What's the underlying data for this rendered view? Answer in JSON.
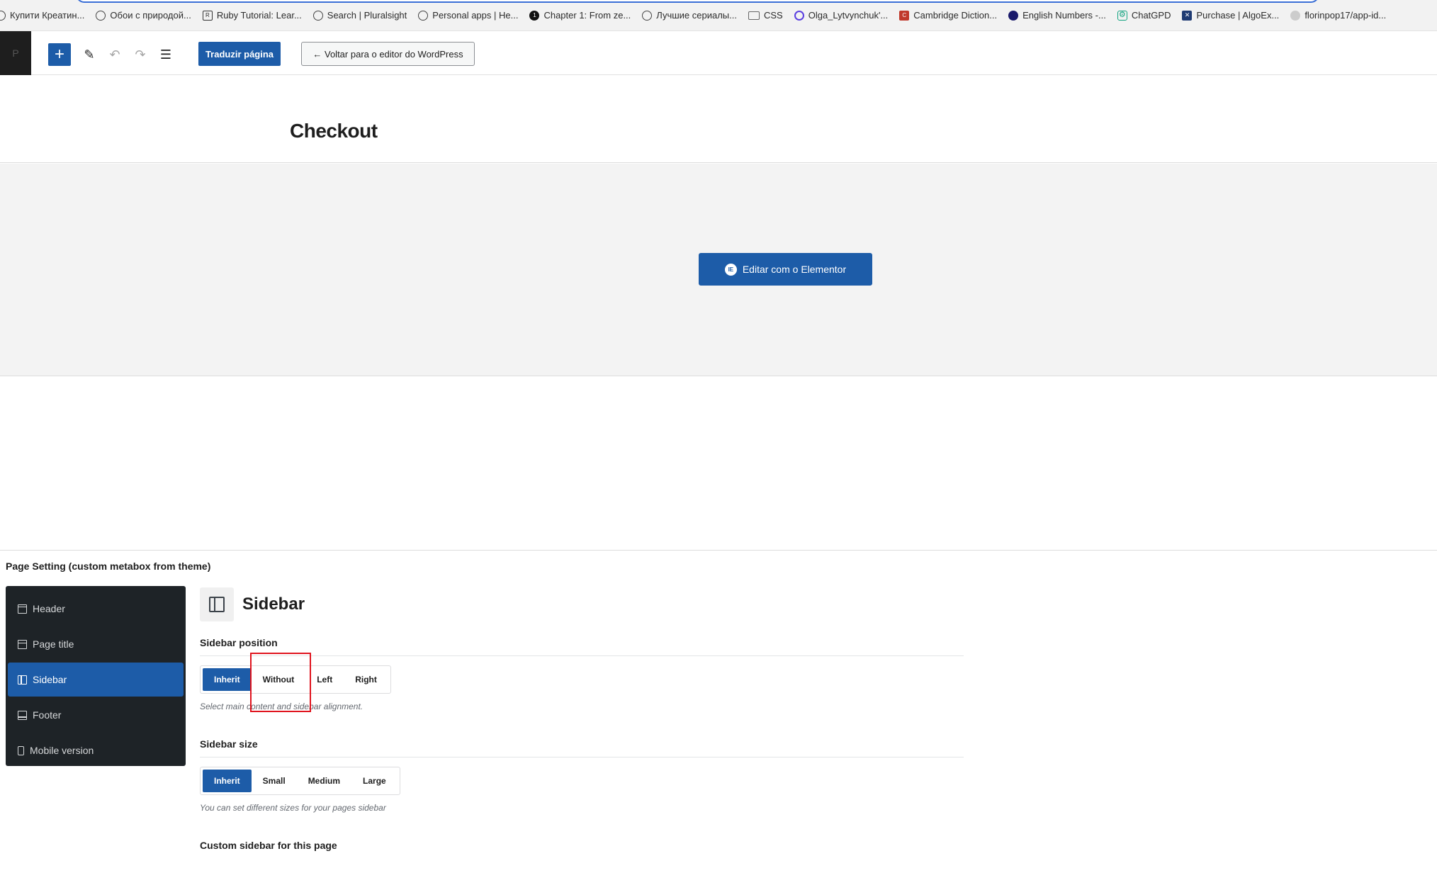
{
  "bookmarks": [
    {
      "icon": "globe-icon",
      "label": "Купити Креатин..."
    },
    {
      "icon": "globe-icon",
      "label": "Обои с природой..."
    },
    {
      "icon": "ruby-icon",
      "label": "Ruby Tutorial: Lear..."
    },
    {
      "icon": "globe-icon",
      "label": "Search | Pluralsight"
    },
    {
      "icon": "globe-icon",
      "label": "Personal apps | He..."
    },
    {
      "icon": "chapter-icon",
      "label": "Chapter 1: From ze..."
    },
    {
      "icon": "globe-icon",
      "label": "Лучшие сериалы..."
    },
    {
      "icon": "folder-icon",
      "label": "CSS"
    },
    {
      "icon": "search-icon",
      "label": "Olga_Lytvynchuk'..."
    },
    {
      "icon": "cambridge-icon",
      "label": "Cambridge Diction..."
    },
    {
      "icon": "dot-icon",
      "label": "English Numbers -..."
    },
    {
      "icon": "chatgpt-icon",
      "label": "ChatGPD"
    },
    {
      "icon": "algoexpert-icon",
      "label": "Purchase | AlgoEx..."
    },
    {
      "icon": "github-icon",
      "label": "florinpop17/app-id..."
    }
  ],
  "toolbar": {
    "add_symbol": "+",
    "edit_symbol": "✎",
    "undo_symbol": "↶",
    "redo_symbol": "↷",
    "outline_symbol": "☰",
    "translate_label": "Traduzir página",
    "back_label": "← Voltar para o editor do WordPress"
  },
  "page": {
    "title": "Checkout",
    "elementor_button": "Editar com o Elementor",
    "elementor_icon_text": "IE"
  },
  "metabox": {
    "title": "Page Setting (custom metabox from theme)",
    "nav": [
      {
        "label": "Header",
        "icon": "header-icon",
        "active": false
      },
      {
        "label": "Page title",
        "icon": "page-title-icon",
        "active": false
      },
      {
        "label": "Sidebar",
        "icon": "sidebar-icon",
        "active": true
      },
      {
        "label": "Footer",
        "icon": "footer-icon",
        "active": false
      },
      {
        "label": "Mobile version",
        "icon": "mobile-icon",
        "active": false
      }
    ],
    "panel": {
      "heading": "Sidebar",
      "sidebar_position": {
        "label": "Sidebar position",
        "options": [
          "Inherit",
          "Without",
          "Left",
          "Right"
        ],
        "selected": "Inherit",
        "help": "Select main content and sidebar alignment."
      },
      "sidebar_size": {
        "label": "Sidebar size",
        "options": [
          "Inherit",
          "Small",
          "Medium",
          "Large"
        ],
        "selected": "Inherit",
        "help": "You can set different sizes for your pages sidebar"
      },
      "custom_sidebar": {
        "label": "Custom sidebar for this page"
      }
    }
  },
  "colors": {
    "accent": "#1d5ca8",
    "nav_background": "#1e2327",
    "highlight": "#e0141e"
  }
}
